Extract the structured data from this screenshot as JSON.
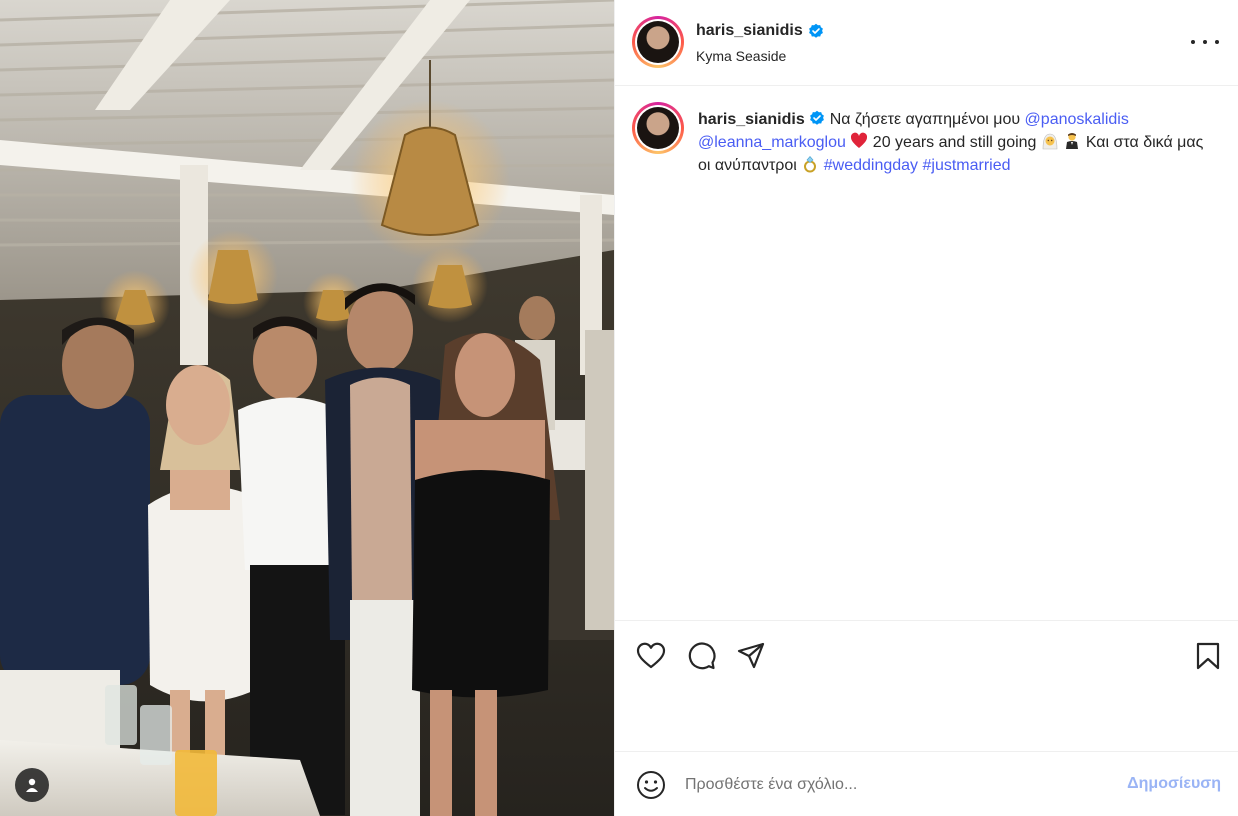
{
  "post": {
    "username": "haris_sianidis",
    "location": "Kyma Seaside",
    "verified": true
  },
  "caption": {
    "username": "haris_sianidis",
    "text_1": "Να ζήσετε αγαπημένοι μου",
    "mention_1": "@panoskalidis",
    "mention_2": "@leanna_markoglou",
    "text_2": "20 years and still going",
    "text_3": "Και στα δικά μας οι ανύπαντροι",
    "hashtag_1": "#weddingday",
    "hashtag_2": "#justmarried",
    "emojis": [
      "red-heart",
      "bride-with-veil",
      "groom-in-tuxedo",
      "ring"
    ]
  },
  "comment": {
    "placeholder": "Προσθέστε ένα σχόλιο...",
    "post_label": "Δημοσίευση"
  },
  "colors": {
    "link": "#4a5df3",
    "post_button_disabled": "#9ab4f5",
    "verified_badge": "#0095f6",
    "text": "#262626"
  },
  "icons": [
    "heart-icon",
    "comment-icon",
    "share-icon",
    "bookmark-icon",
    "emoji-icon",
    "more-options-icon",
    "user-tag-icon",
    "verified-badge-icon"
  ]
}
